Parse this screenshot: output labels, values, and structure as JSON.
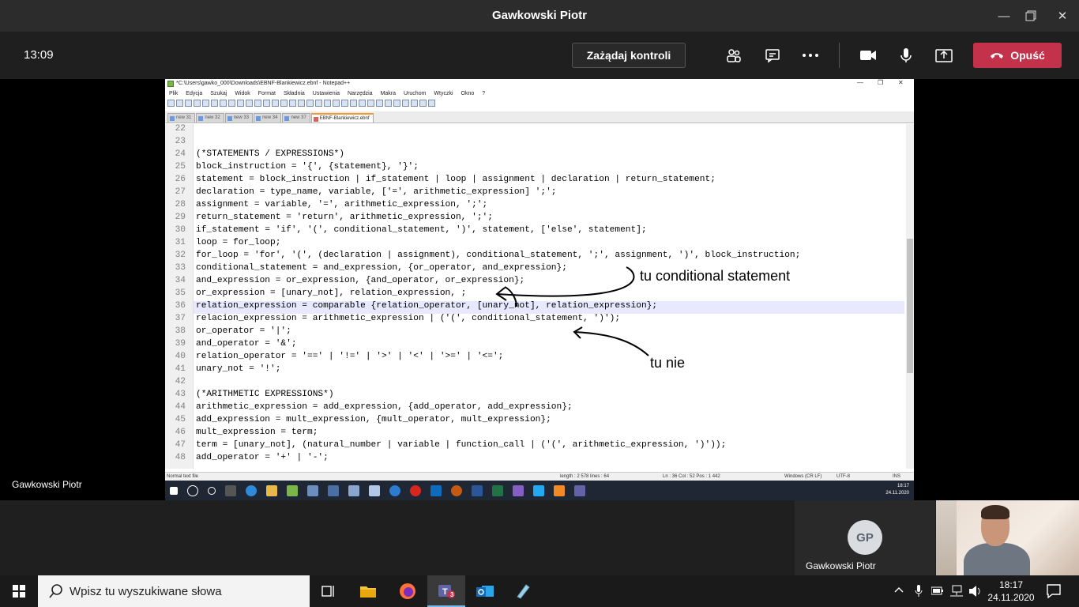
{
  "window": {
    "title": "Gawkowski Piotr"
  },
  "callbar": {
    "time": "13:09",
    "request_control": "Zażądaj kontroli",
    "leave": "Opuść",
    "icons": [
      "participants-icon",
      "chat-icon",
      "more-icon",
      "camera-icon",
      "mic-icon",
      "share-icon",
      "hangup-icon"
    ]
  },
  "notepad": {
    "title": "*C:\\Users\\gawko_000\\Downloads\\EBNF-Blankiewicz.ebnf - Notepad++",
    "menu": [
      "Plik",
      "Edycja",
      "Szukaj",
      "Widok",
      "Format",
      "Składnia",
      "Ustawienia",
      "Narzędzia",
      "Makra",
      "Uruchom",
      "Wtyczki",
      "Okno",
      "?"
    ],
    "tabs": [
      "new 31",
      "new 32",
      "new 33",
      "new 34",
      "new 37",
      "EBNF-Blankiewicz.ebnf"
    ],
    "active_tab": "EBNF-Blankiewicz.ebnf",
    "lines": [
      {
        "n": "22",
        "t": ""
      },
      {
        "n": "23",
        "t": ""
      },
      {
        "n": "24",
        "t": "(*STATEMENTS / EXPRESSIONS*)"
      },
      {
        "n": "25",
        "t": "block_instruction = '{', {statement}, '}';"
      },
      {
        "n": "26",
        "t": "statement = block_instruction | if_statement | loop | assignment | declaration | return_statement;"
      },
      {
        "n": "27",
        "t": "declaration = type_name, variable, ['=', arithmetic_expression] ';';"
      },
      {
        "n": "28",
        "t": "assignment = variable, '=', arithmetic_expression, ';';"
      },
      {
        "n": "29",
        "t": "return_statement = 'return', arithmetic_expression, ';';"
      },
      {
        "n": "30",
        "t": "if_statement = 'if', '(', conditional_statement, ')', statement, ['else', statement];"
      },
      {
        "n": "31",
        "t": "loop = for_loop;"
      },
      {
        "n": "32",
        "t": "for_loop = 'for', '(', (declaration | assignment), conditional_statement, ';', assignment, ')', block_instruction;"
      },
      {
        "n": "33",
        "t": "conditional_statement = and_expression, {or_operator, and_expression};"
      },
      {
        "n": "34",
        "t": "and_expression = or_expression, {and_operator, or_expression};"
      },
      {
        "n": "35",
        "t": "or_expression = [unary_not], relation_expression, ;"
      },
      {
        "n": "36",
        "t": "relation_expression = comparable {relation_operator, [unary_not], relation_expression};"
      },
      {
        "n": "37",
        "t": "relacion_expression = arithmetic_expression | ('(', conditional_statement, ')');"
      },
      {
        "n": "38",
        "t": "or_operator = '|';"
      },
      {
        "n": "39",
        "t": "and_operator = '&';"
      },
      {
        "n": "40",
        "t": "relation_operator = '==' | '!=' | '>' | '<' | '>=' | '<=';"
      },
      {
        "n": "41",
        "t": "unary_not = '!';"
      },
      {
        "n": "42",
        "t": ""
      },
      {
        "n": "43",
        "t": "(*ARITHMETIC EXPRESSIONS*)"
      },
      {
        "n": "44",
        "t": "arithmetic_expression = add_expression, {add_operator, add_expression};"
      },
      {
        "n": "45",
        "t": "add_expression = mult_expression, {mult_operator, mult_expression};"
      },
      {
        "n": "46",
        "t": "mult_expression = term;"
      },
      {
        "n": "47",
        "t": "term = [unary_not], (natural_number | variable | function_call | ('(', arithmetic_expression, ')'));"
      },
      {
        "n": "48",
        "t": "add_operator = '+' | '-';"
      }
    ],
    "status": {
      "type": "Normal text file",
      "length": "length : 2 578   lines : 64",
      "pos": "Ln : 36   Col : 52   Pos : 1 442",
      "eol": "Windows (CR LF)",
      "enc": "UTF-8",
      "mode": "INS"
    },
    "inner_clock": {
      "time": "18:17",
      "date": "24.11.2020"
    }
  },
  "annotations": {
    "a1": "tu conditional statement",
    "a2": "tu nie"
  },
  "presenter": "Gawkowski Piotr",
  "participant": {
    "initials": "GP",
    "name": "Gawkowski Piotr"
  },
  "taskbar": {
    "search_placeholder": "Wpisz tu wyszukiwane słowa",
    "time": "18:17",
    "date": "24.11.2020",
    "teams_badge": "3"
  }
}
